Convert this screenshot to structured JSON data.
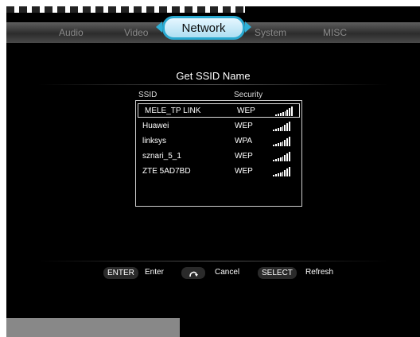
{
  "tabs": {
    "audio": "Audio",
    "video": "Video",
    "network": "Network",
    "system": "System",
    "misc": "MISC"
  },
  "page_title": "Get SSID Name",
  "columns": {
    "ssid": "SSID",
    "security": "Security"
  },
  "networks": [
    {
      "ssid": "MELE_TP LINK",
      "security": "WEP",
      "signal": 5
    },
    {
      "ssid": "Huawei",
      "security": "WEP",
      "signal": 5
    },
    {
      "ssid": "linksys",
      "security": "WPA",
      "signal": 5
    },
    {
      "ssid": "sznari_5_1",
      "security": "WEP",
      "signal": 5
    },
    {
      "ssid": "ZTE 5AD7BD",
      "security": "WEP",
      "signal": 5
    }
  ],
  "footer": {
    "enter_key": "ENTER",
    "enter_label": "Enter",
    "cancel_label": "Cancel",
    "select_key": "SELECT",
    "refresh_label": "Refresh"
  },
  "colors": {
    "accent": "#29a8cf",
    "background": "#000000"
  }
}
